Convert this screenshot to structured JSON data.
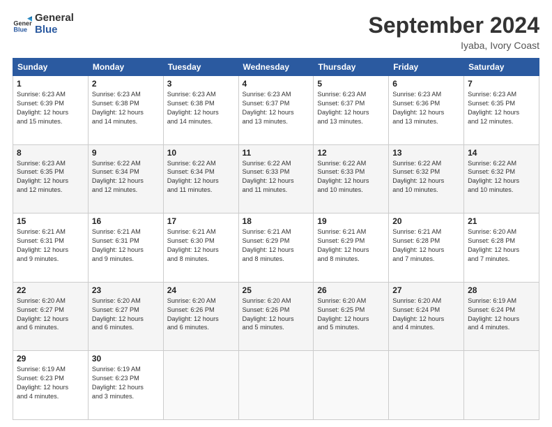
{
  "header": {
    "logo_line1": "General",
    "logo_line2": "Blue",
    "month_title": "September 2024",
    "location": "Iyaba, Ivory Coast"
  },
  "weekdays": [
    "Sunday",
    "Monday",
    "Tuesday",
    "Wednesday",
    "Thursday",
    "Friday",
    "Saturday"
  ],
  "weeks": [
    [
      {
        "day": "1",
        "info": "Sunrise: 6:23 AM\nSunset: 6:39 PM\nDaylight: 12 hours\nand 15 minutes."
      },
      {
        "day": "2",
        "info": "Sunrise: 6:23 AM\nSunset: 6:38 PM\nDaylight: 12 hours\nand 14 minutes."
      },
      {
        "day": "3",
        "info": "Sunrise: 6:23 AM\nSunset: 6:38 PM\nDaylight: 12 hours\nand 14 minutes."
      },
      {
        "day": "4",
        "info": "Sunrise: 6:23 AM\nSunset: 6:37 PM\nDaylight: 12 hours\nand 13 minutes."
      },
      {
        "day": "5",
        "info": "Sunrise: 6:23 AM\nSunset: 6:37 PM\nDaylight: 12 hours\nand 13 minutes."
      },
      {
        "day": "6",
        "info": "Sunrise: 6:23 AM\nSunset: 6:36 PM\nDaylight: 12 hours\nand 13 minutes."
      },
      {
        "day": "7",
        "info": "Sunrise: 6:23 AM\nSunset: 6:35 PM\nDaylight: 12 hours\nand 12 minutes."
      }
    ],
    [
      {
        "day": "8",
        "info": "Sunrise: 6:23 AM\nSunset: 6:35 PM\nDaylight: 12 hours\nand 12 minutes."
      },
      {
        "day": "9",
        "info": "Sunrise: 6:22 AM\nSunset: 6:34 PM\nDaylight: 12 hours\nand 12 minutes."
      },
      {
        "day": "10",
        "info": "Sunrise: 6:22 AM\nSunset: 6:34 PM\nDaylight: 12 hours\nand 11 minutes."
      },
      {
        "day": "11",
        "info": "Sunrise: 6:22 AM\nSunset: 6:33 PM\nDaylight: 12 hours\nand 11 minutes."
      },
      {
        "day": "12",
        "info": "Sunrise: 6:22 AM\nSunset: 6:33 PM\nDaylight: 12 hours\nand 10 minutes."
      },
      {
        "day": "13",
        "info": "Sunrise: 6:22 AM\nSunset: 6:32 PM\nDaylight: 12 hours\nand 10 minutes."
      },
      {
        "day": "14",
        "info": "Sunrise: 6:22 AM\nSunset: 6:32 PM\nDaylight: 12 hours\nand 10 minutes."
      }
    ],
    [
      {
        "day": "15",
        "info": "Sunrise: 6:21 AM\nSunset: 6:31 PM\nDaylight: 12 hours\nand 9 minutes."
      },
      {
        "day": "16",
        "info": "Sunrise: 6:21 AM\nSunset: 6:31 PM\nDaylight: 12 hours\nand 9 minutes."
      },
      {
        "day": "17",
        "info": "Sunrise: 6:21 AM\nSunset: 6:30 PM\nDaylight: 12 hours\nand 8 minutes."
      },
      {
        "day": "18",
        "info": "Sunrise: 6:21 AM\nSunset: 6:29 PM\nDaylight: 12 hours\nand 8 minutes."
      },
      {
        "day": "19",
        "info": "Sunrise: 6:21 AM\nSunset: 6:29 PM\nDaylight: 12 hours\nand 8 minutes."
      },
      {
        "day": "20",
        "info": "Sunrise: 6:21 AM\nSunset: 6:28 PM\nDaylight: 12 hours\nand 7 minutes."
      },
      {
        "day": "21",
        "info": "Sunrise: 6:20 AM\nSunset: 6:28 PM\nDaylight: 12 hours\nand 7 minutes."
      }
    ],
    [
      {
        "day": "22",
        "info": "Sunrise: 6:20 AM\nSunset: 6:27 PM\nDaylight: 12 hours\nand 6 minutes."
      },
      {
        "day": "23",
        "info": "Sunrise: 6:20 AM\nSunset: 6:27 PM\nDaylight: 12 hours\nand 6 minutes."
      },
      {
        "day": "24",
        "info": "Sunrise: 6:20 AM\nSunset: 6:26 PM\nDaylight: 12 hours\nand 6 minutes."
      },
      {
        "day": "25",
        "info": "Sunrise: 6:20 AM\nSunset: 6:26 PM\nDaylight: 12 hours\nand 5 minutes."
      },
      {
        "day": "26",
        "info": "Sunrise: 6:20 AM\nSunset: 6:25 PM\nDaylight: 12 hours\nand 5 minutes."
      },
      {
        "day": "27",
        "info": "Sunrise: 6:20 AM\nSunset: 6:24 PM\nDaylight: 12 hours\nand 4 minutes."
      },
      {
        "day": "28",
        "info": "Sunrise: 6:19 AM\nSunset: 6:24 PM\nDaylight: 12 hours\nand 4 minutes."
      }
    ],
    [
      {
        "day": "29",
        "info": "Sunrise: 6:19 AM\nSunset: 6:23 PM\nDaylight: 12 hours\nand 4 minutes."
      },
      {
        "day": "30",
        "info": "Sunrise: 6:19 AM\nSunset: 6:23 PM\nDaylight: 12 hours\nand 3 minutes."
      },
      {
        "day": "",
        "info": ""
      },
      {
        "day": "",
        "info": ""
      },
      {
        "day": "",
        "info": ""
      },
      {
        "day": "",
        "info": ""
      },
      {
        "day": "",
        "info": ""
      }
    ]
  ]
}
